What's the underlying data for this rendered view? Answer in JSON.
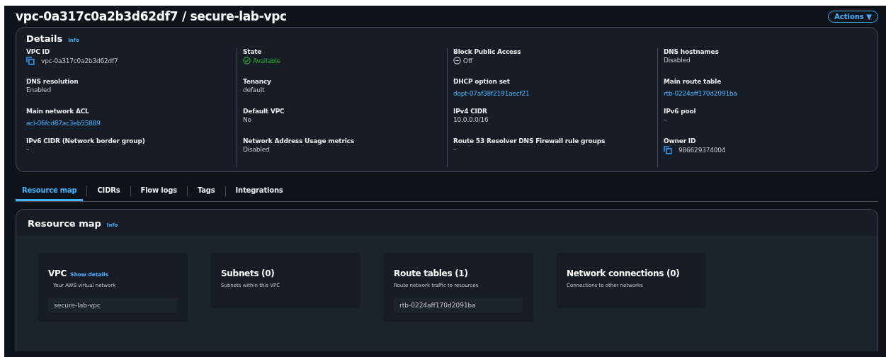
{
  "header": {
    "title": "vpc-0a317c0a2b3d62df7 / secure-lab-vpc",
    "actions_button": "Actions ▼"
  },
  "details": {
    "title": "Details",
    "info": "Info",
    "columns": [
      [
        {
          "label": "VPC ID",
          "value": "vpc-0a317c0a2b3d62df7",
          "kind": "copy"
        },
        {
          "label": "DNS resolution",
          "value": "Enabled",
          "kind": "text"
        },
        {
          "label": "Main network ACL",
          "value": "acl-06fcd87ac3eb55889",
          "kind": "link"
        },
        {
          "label": "IPv6 CIDR (Network border group)",
          "value": "–",
          "kind": "text"
        }
      ],
      [
        {
          "label": "State",
          "value": "Available",
          "kind": "available"
        },
        {
          "label": "Tenancy",
          "value": "default",
          "kind": "text"
        },
        {
          "label": "Default VPC",
          "value": "No",
          "kind": "text"
        },
        {
          "label": "Network Address Usage metrics",
          "value": "Disabled",
          "kind": "text"
        }
      ],
      [
        {
          "label": "Block Public Access",
          "value": "Off",
          "kind": "off"
        },
        {
          "label": "DHCP option set",
          "value": "dopt-07af38f2191aecf21",
          "kind": "link"
        },
        {
          "label": "IPv4 CIDR",
          "value": "10.0.0.0/16",
          "kind": "text"
        },
        {
          "label": "Route 53 Resolver DNS Firewall rule groups",
          "value": "–",
          "kind": "text"
        }
      ],
      [
        {
          "label": "DNS hostnames",
          "value": "Disabled",
          "kind": "text"
        },
        {
          "label": "Main route table",
          "value": "rtb-0224aff170d2091ba",
          "kind": "link"
        },
        {
          "label": "IPv6 pool",
          "value": "–",
          "kind": "text"
        },
        {
          "label": "Owner ID",
          "value": "986629374004",
          "kind": "copy"
        }
      ]
    ]
  },
  "tabs": [
    {
      "label": "Resource map",
      "selected": true
    },
    {
      "label": "CIDRs",
      "selected": false
    },
    {
      "label": "Flow logs",
      "selected": false
    },
    {
      "label": "Tags",
      "selected": false
    },
    {
      "label": "Integrations",
      "selected": false
    }
  ],
  "resource_map": {
    "title": "Resource map",
    "info": "Info",
    "cards": [
      {
        "title": "VPC",
        "link": "Show details",
        "subtitle": "Your AWS virtual network",
        "items": [
          "secure-lab-vpc"
        ]
      },
      {
        "title": "Subnets (0)",
        "subtitle": "Subnets within this VPC"
      },
      {
        "title": "Route tables (1)",
        "subtitle": "Route network traffic to resources",
        "items": [
          "rtb-0224aff170d2091ba"
        ]
      },
      {
        "title": "Network connections (0)",
        "subtitle": "Connections to other networks"
      }
    ]
  }
}
